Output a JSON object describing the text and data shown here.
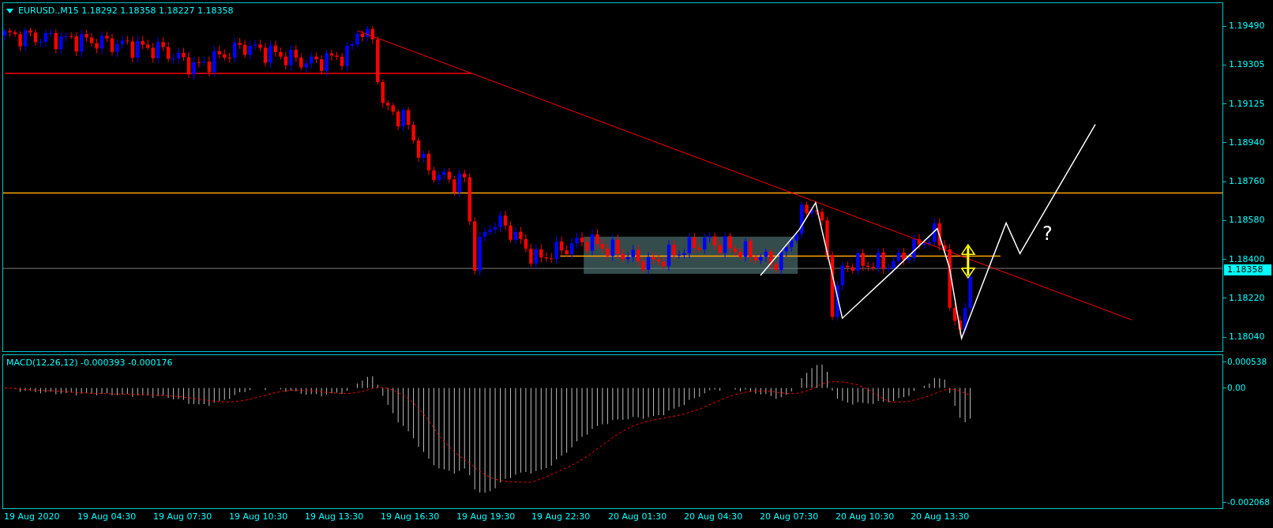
{
  "header": {
    "symbol": "EURUSD.,M15",
    "quote": "1.18292 1.18358 1.18227 1.18358"
  },
  "price_axis": [
    "1.19490",
    "1.19305",
    "1.19125",
    "1.18940",
    "1.18760",
    "1.18580",
    "1.18400",
    "1.18220",
    "1.18040"
  ],
  "current_price": "1.18358",
  "annotation": "?",
  "macd": {
    "label": "MACD(12,26,12) -0.000393 -0.000176",
    "axis": [
      "0.000538",
      "0.00",
      "-0.002068"
    ]
  },
  "time_axis": [
    "19 Aug 2020",
    "19 Aug 04:30",
    "19 Aug 07:30",
    "19 Aug 10:30",
    "19 Aug 13:30",
    "19 Aug 16:30",
    "19 Aug 19:30",
    "19 Aug 22:30",
    "20 Aug 01:30",
    "20 Aug 04:30",
    "20 Aug 07:30",
    "20 Aug 10:30",
    "20 Aug 13:30"
  ]
}
